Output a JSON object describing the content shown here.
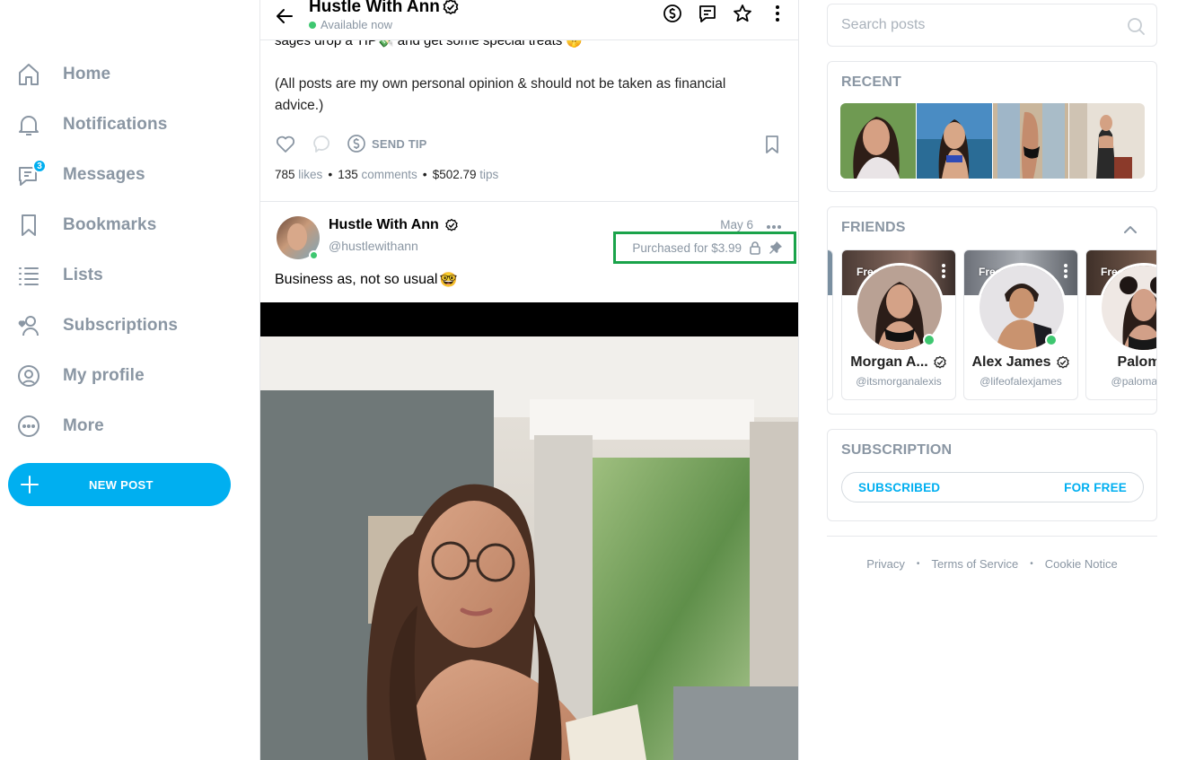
{
  "nav": {
    "items": [
      {
        "label": "Home",
        "icon": "home-icon"
      },
      {
        "label": "Notifications",
        "icon": "bell-icon"
      },
      {
        "label": "Messages",
        "icon": "chat-icon",
        "badge": "3"
      },
      {
        "label": "Bookmarks",
        "icon": "bookmark-icon"
      },
      {
        "label": "Lists",
        "icon": "list-icon"
      },
      {
        "label": "Subscriptions",
        "icon": "user-heart-icon"
      },
      {
        "label": "My profile",
        "icon": "profile-circle-icon"
      },
      {
        "label": "More",
        "icon": "more-circle-icon"
      }
    ],
    "new_post_label": "NEW POST"
  },
  "header": {
    "title": "Hustle With Ann",
    "status": "Available now"
  },
  "post1": {
    "tail_text": "sages drop a TIP💸 and get some special treats 🤫",
    "text": "(All posts are my own personal opinion & should not be taken as financial advice.)",
    "send_tip_label": "SEND TIP",
    "likes": "785",
    "likes_label": "likes",
    "comments": "135",
    "comments_label": "comments",
    "tips": "$502.79",
    "tips_label": "tips"
  },
  "post2": {
    "author": "Hustle With Ann",
    "handle": "@hustlewithann",
    "date": "May 6",
    "purchased": "Purchased for $3.99",
    "text": "Business as, not so usual",
    "emoji": "🤓"
  },
  "search": {
    "placeholder": "Search posts"
  },
  "recent": {
    "title": "RECENT",
    "count": 4
  },
  "friends": {
    "title": "FRIENDS",
    "items": [
      {
        "badge": "Free",
        "name": "Morgan A...",
        "handle": "@itsmorganalexis"
      },
      {
        "badge": "Free",
        "name": "Alex James",
        "handle": "@lifeofalexjames"
      },
      {
        "badge": "Free",
        "name": "Paloma",
        "handle": "@palomashe"
      }
    ]
  },
  "subscription": {
    "title": "SUBSCRIPTION",
    "status": "SUBSCRIBED",
    "price": "FOR FREE"
  },
  "footer": {
    "links": [
      "Privacy",
      "Terms of Service",
      "Cookie Notice"
    ]
  },
  "colors": {
    "accent": "#00aff0",
    "muted": "#8a96a3",
    "online": "#3ec770",
    "highlight": "#1aa34a",
    "border": "#e6e8eb"
  }
}
